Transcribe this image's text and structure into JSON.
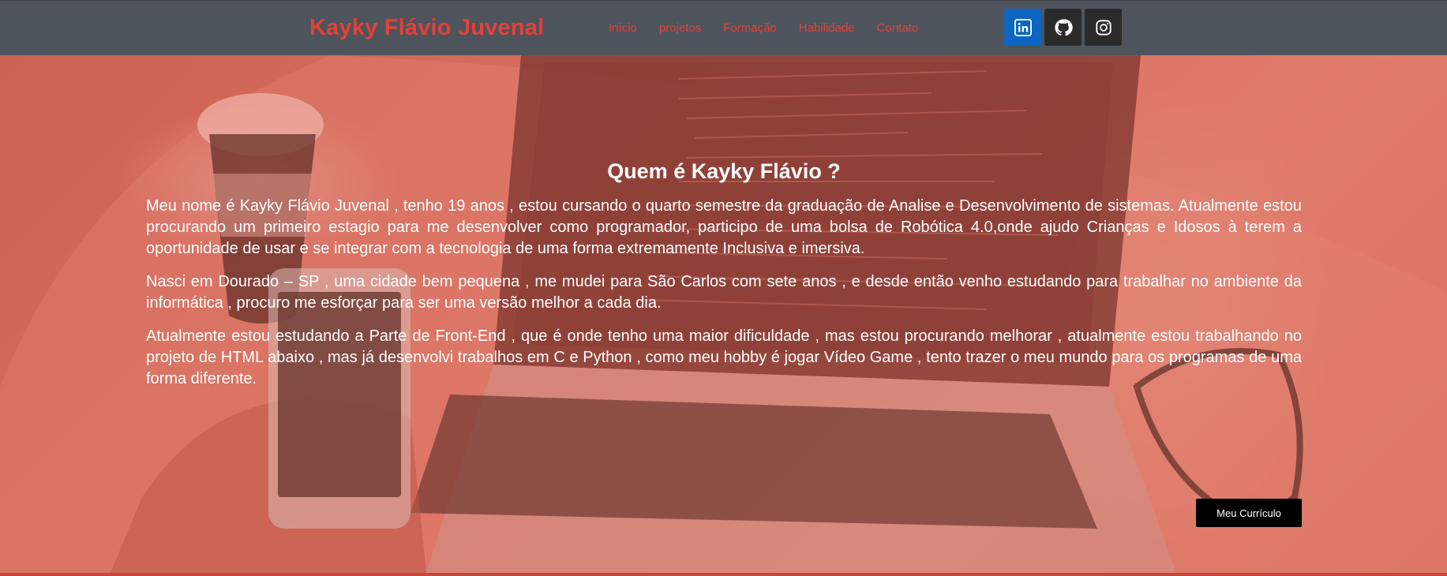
{
  "header": {
    "brand": "Kayky Flávio Juvenal",
    "nav": [
      "Início",
      "projetos",
      "Formação",
      "Habilidade",
      "Contato"
    ],
    "social": [
      {
        "icon": "linkedin-icon",
        "color": "#0a66c2"
      },
      {
        "icon": "github-icon",
        "color": "#2b2b2b"
      },
      {
        "icon": "instagram-icon",
        "color": "#2b2b2b"
      }
    ]
  },
  "about": {
    "title": "Quem é Kayky Flávio ?",
    "paragraphs": [
      "Meu nome é Kayky Flávio Juvenal , tenho 19 anos , estou cursando o quarto semestre da graduação de Analise e Desenvolvimento de sistemas. Atualmente estou procurando um primeiro estagio para me desenvolver como programador, participo de uma bolsa de Robótica 4.0,onde ajudo Crianças e Idosos à terem a oportunidade de usar e se integrar com a tecnologia de uma forma extremamente Inclusiva e imersiva.",
      "Nasci em Dourado – SP , uma cidade bem pequena , me mudei para São Carlos com sete anos , e desde então venho estudando para trabalhar no ambiente da informática , procuro me esforçar para ser uma versão melhor a cada dia.",
      "Atualmente estou estudando a Parte de Front-End , que é onde tenho uma maior dificuldade  , mas estou procurando melhorar , atualmente estou trabalhando no projeto de HTML abaixo , mas já desenvolvi trabalhos em C e Python , como meu hobby é jogar Vídeo Game , tento trazer o meu mundo para os programas de uma forma diferente."
    ],
    "cv_button": "Meu Currículo"
  },
  "colors": {
    "accent": "#e2413a",
    "topbar": "#4e545c",
    "hero_overlay": "#e25a48"
  }
}
